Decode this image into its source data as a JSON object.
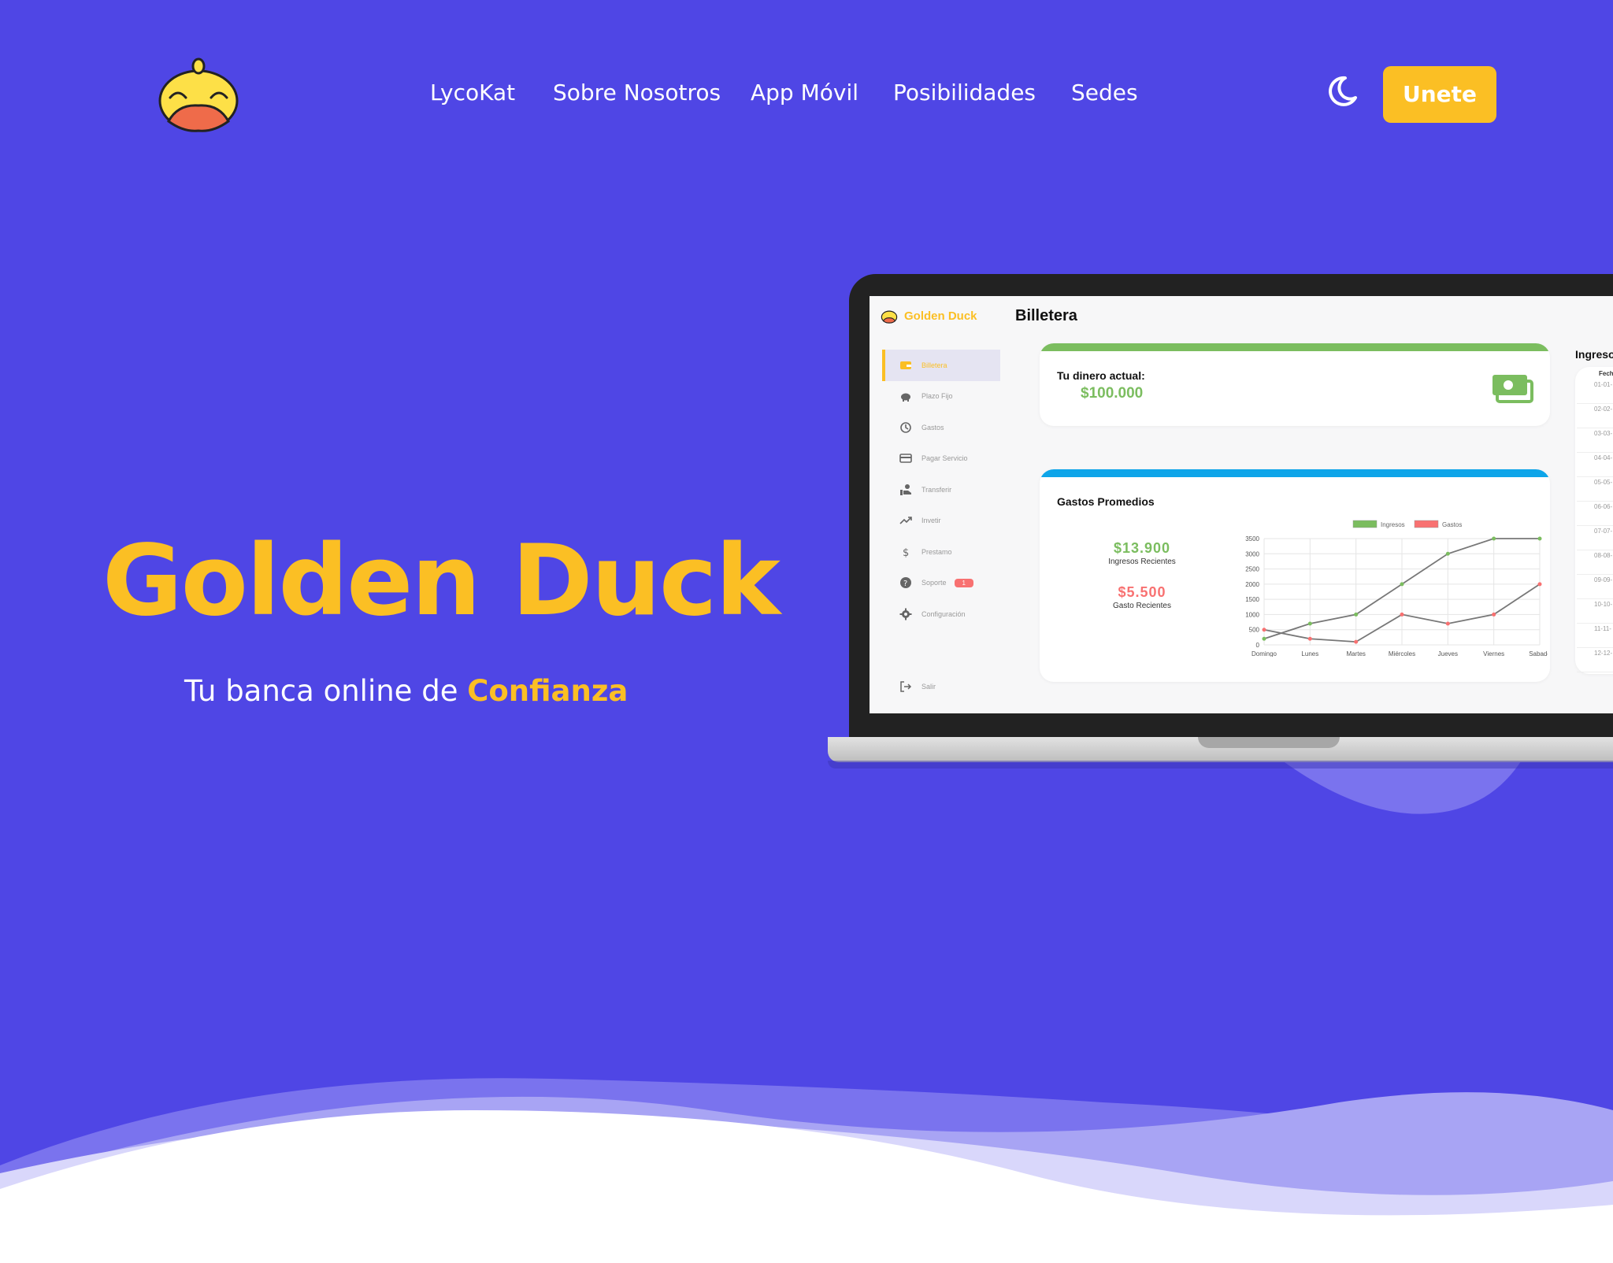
{
  "nav": {
    "links": [
      "LycoKat",
      "Sobre Nosotros",
      "App Móvil",
      "Posibilidades",
      "Sedes"
    ],
    "join_label": "Unete"
  },
  "hero": {
    "title": "Golden Duck",
    "subtitle_prefix": "Tu banca online de ",
    "subtitle_highlight": "Confianza"
  },
  "dashboard": {
    "brand": "Golden Duck",
    "page_title": "Billetera",
    "menu": [
      {
        "label": "Billetera",
        "icon": "wallet-icon",
        "active": true
      },
      {
        "label": "Plazo Fijo",
        "icon": "piggy-bank-icon"
      },
      {
        "label": "Gastos",
        "icon": "history-icon"
      },
      {
        "label": "Pagar Servicio",
        "icon": "credit-card-icon"
      },
      {
        "label": "Transferir",
        "icon": "hand-transfer-icon"
      },
      {
        "label": "Invetir",
        "icon": "trending-up-icon"
      },
      {
        "label": "Prestamo",
        "icon": "dollar-icon"
      },
      {
        "label": "Soporte",
        "icon": "help-icon",
        "badge": "1"
      },
      {
        "label": "Configuración",
        "icon": "gear-icon"
      }
    ],
    "logout": "Salir",
    "balance": {
      "label": "Tu dinero actual:",
      "value": "$100.000"
    },
    "averages": {
      "title": "Gastos Promedios",
      "income_value": "$13.900",
      "income_label": "Ingresos Recientes",
      "expense_value": "$5.500",
      "expense_label": "Gasto Recientes"
    },
    "income_table": {
      "title": "Ingreso",
      "header": "Fech",
      "rows": [
        "01-01-",
        "02-02-",
        "03-03-",
        "04-04-",
        "05-05-",
        "06-06-",
        "07-07-",
        "08-08-",
        "09-09-",
        "10-10-",
        "11-11-",
        "12-12-"
      ]
    }
  },
  "colors": {
    "background": "#4f46e5",
    "accent": "#fbbf24",
    "income": "#7bbd5f",
    "expense": "#f87171",
    "info": "#0ea5e9"
  },
  "chart_data": {
    "type": "line",
    "categories": [
      "Domingo",
      "Lunes",
      "Martes",
      "Miércoles",
      "Jueves",
      "Viernes",
      "Sabado"
    ],
    "series": [
      {
        "name": "Ingresos",
        "values": [
          200,
          700,
          1000,
          2000,
          3000,
          3500,
          3500
        ],
        "color": "#7bbd5f"
      },
      {
        "name": "Gastos",
        "values": [
          500,
          200,
          100,
          1000,
          700,
          1000,
          2000
        ],
        "color": "#f87171"
      }
    ],
    "yticks": [
      0,
      500,
      1000,
      1500,
      2000,
      2500,
      3000,
      3500
    ],
    "ylim": [
      0,
      3500
    ],
    "grid": true,
    "legend": "top"
  }
}
